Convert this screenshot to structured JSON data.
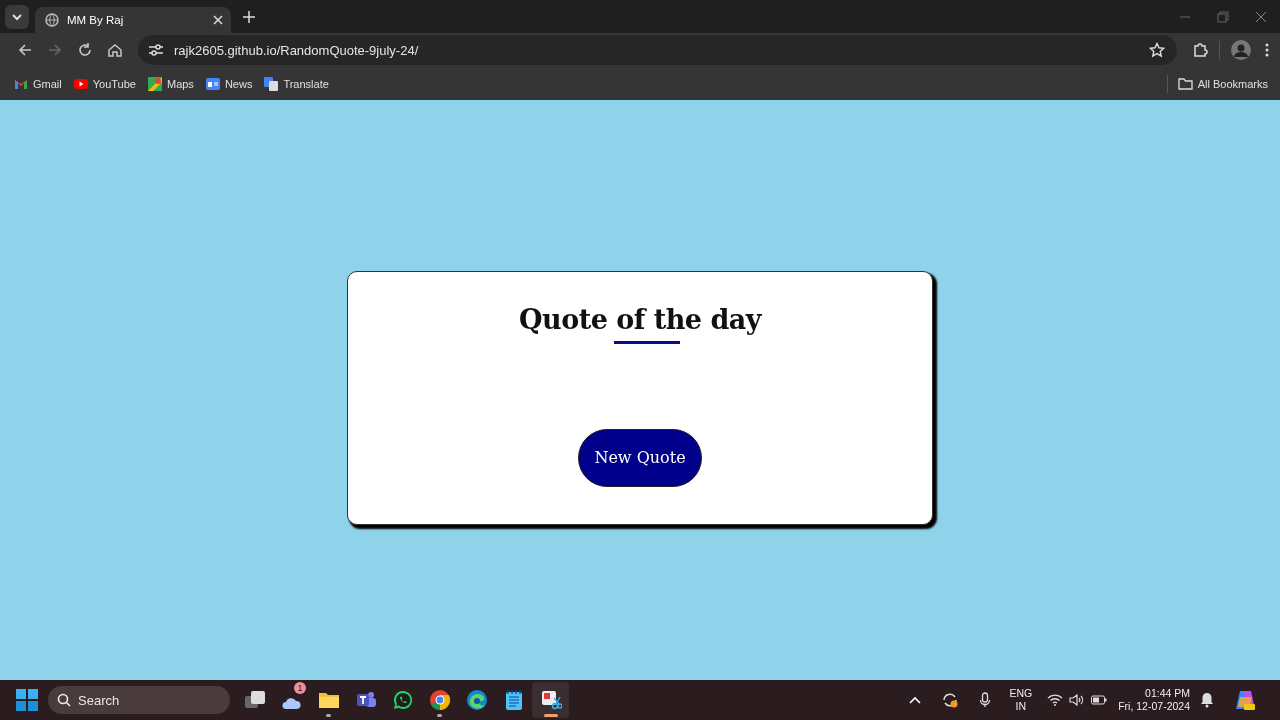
{
  "browser": {
    "tabs": [
      {
        "title": "MM By Raj",
        "selected": true
      }
    ],
    "url": "rajk2605.github.io/RandomQuote-9july-24/",
    "bookmarks": [
      {
        "kind": "gmail",
        "label": "Gmail"
      },
      {
        "kind": "youtube",
        "label": "YouTube"
      },
      {
        "kind": "maps",
        "label": "Maps"
      },
      {
        "kind": "news",
        "label": "News"
      },
      {
        "kind": "translate",
        "label": "Translate"
      }
    ],
    "all_bookmarks": "All Bookmarks"
  },
  "card": {
    "title": "Quote of the day",
    "button": "New Quote"
  },
  "taskbar": {
    "search": {
      "placeholder": "Search"
    },
    "apps": [
      {
        "kind": "taskview",
        "running": false,
        "active": false
      },
      {
        "kind": "weather",
        "running": false,
        "active": false,
        "badge": "1"
      },
      {
        "kind": "folder",
        "running": true,
        "active": false
      },
      {
        "kind": "teams",
        "running": false,
        "active": false
      },
      {
        "kind": "whatsapp",
        "running": false,
        "active": false
      },
      {
        "kind": "chrome",
        "running": true,
        "active": false
      },
      {
        "kind": "edge",
        "running": false,
        "active": false
      },
      {
        "kind": "notepad",
        "running": false,
        "active": false
      },
      {
        "kind": "snip",
        "running": true,
        "active": true
      }
    ],
    "language": [
      "ENG",
      "IN"
    ],
    "time": "01:44 PM",
    "date": "Fri, 12-07-2024"
  }
}
